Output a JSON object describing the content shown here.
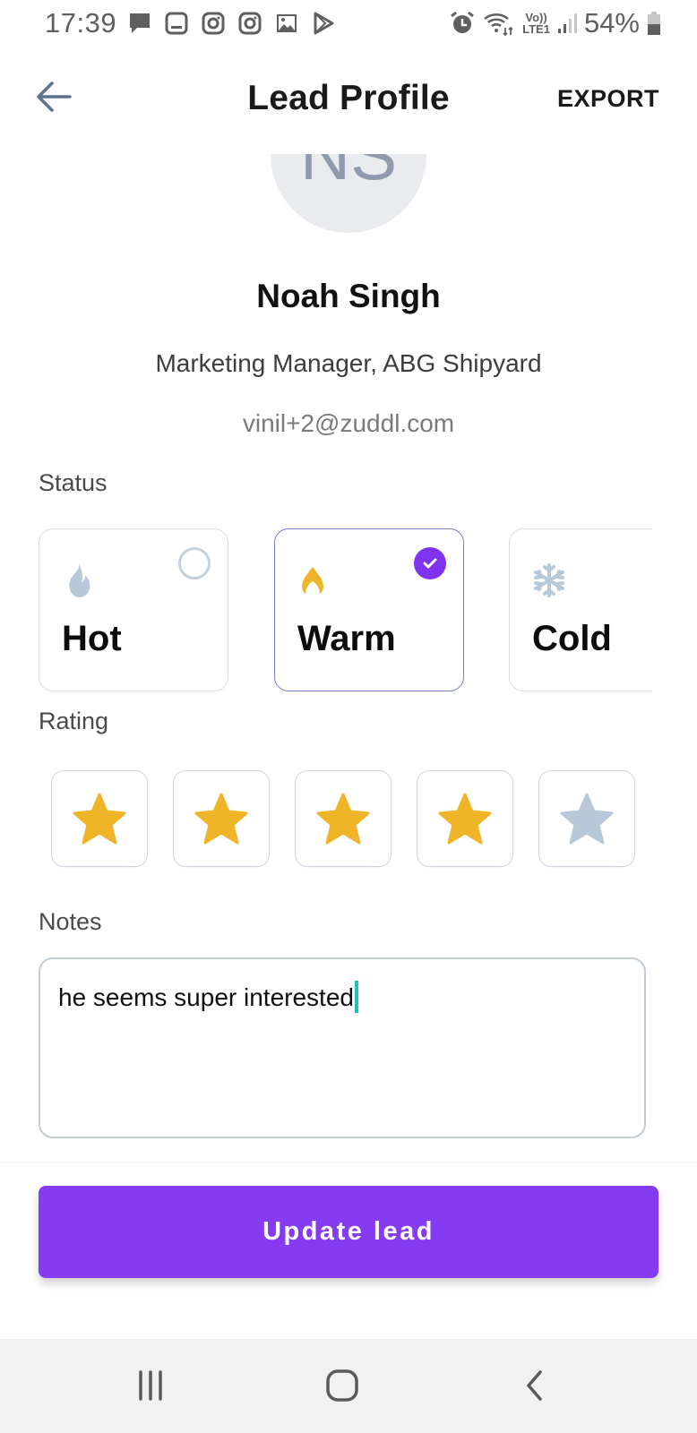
{
  "status_bar": {
    "time": "17:39",
    "notification_icons": [
      "message-icon",
      "app-icon",
      "instagram-icon",
      "instagram-icon",
      "gallery-icon",
      "play-store-icon"
    ],
    "system_icons": [
      "alarm-icon",
      "wifi-icon",
      "volte-lte-icon",
      "signal-icon"
    ],
    "volte_label_top": "Vo))",
    "volte_label_bottom": "LTE1",
    "battery_percent": "54%",
    "battery_level": 0.54
  },
  "header": {
    "back_icon": "arrow-left-icon",
    "title": "Lead Profile",
    "export_label": "EXPORT"
  },
  "profile": {
    "initials": "NS",
    "name": "Noah Singh",
    "role": "Marketing Manager, ABG Shipyard",
    "email": "vinil+2@zuddl.com"
  },
  "status": {
    "label": "Status",
    "selected": "Warm",
    "options": [
      {
        "label": "Hot",
        "icon": "fire-icon",
        "icon_color": "#b9c8d8",
        "selected": false
      },
      {
        "label": "Warm",
        "icon": "flame-icon",
        "icon_color": "#f0b429",
        "selected": true
      },
      {
        "label": "Cold",
        "icon": "snowflake-icon",
        "icon_color": "#b9c8d8",
        "selected": false
      }
    ]
  },
  "rating": {
    "label": "Rating",
    "value": 4,
    "max": 5,
    "filled_color": "#f0b429",
    "empty_color": "#b9c8d8"
  },
  "notes": {
    "label": "Notes",
    "value": "he seems super interested"
  },
  "footer": {
    "update_label": "Update lead",
    "accent": "#853bf2"
  },
  "navbar": {
    "recents_icon": "recents-icon",
    "home_icon": "home-icon",
    "back_icon": "back-icon"
  }
}
